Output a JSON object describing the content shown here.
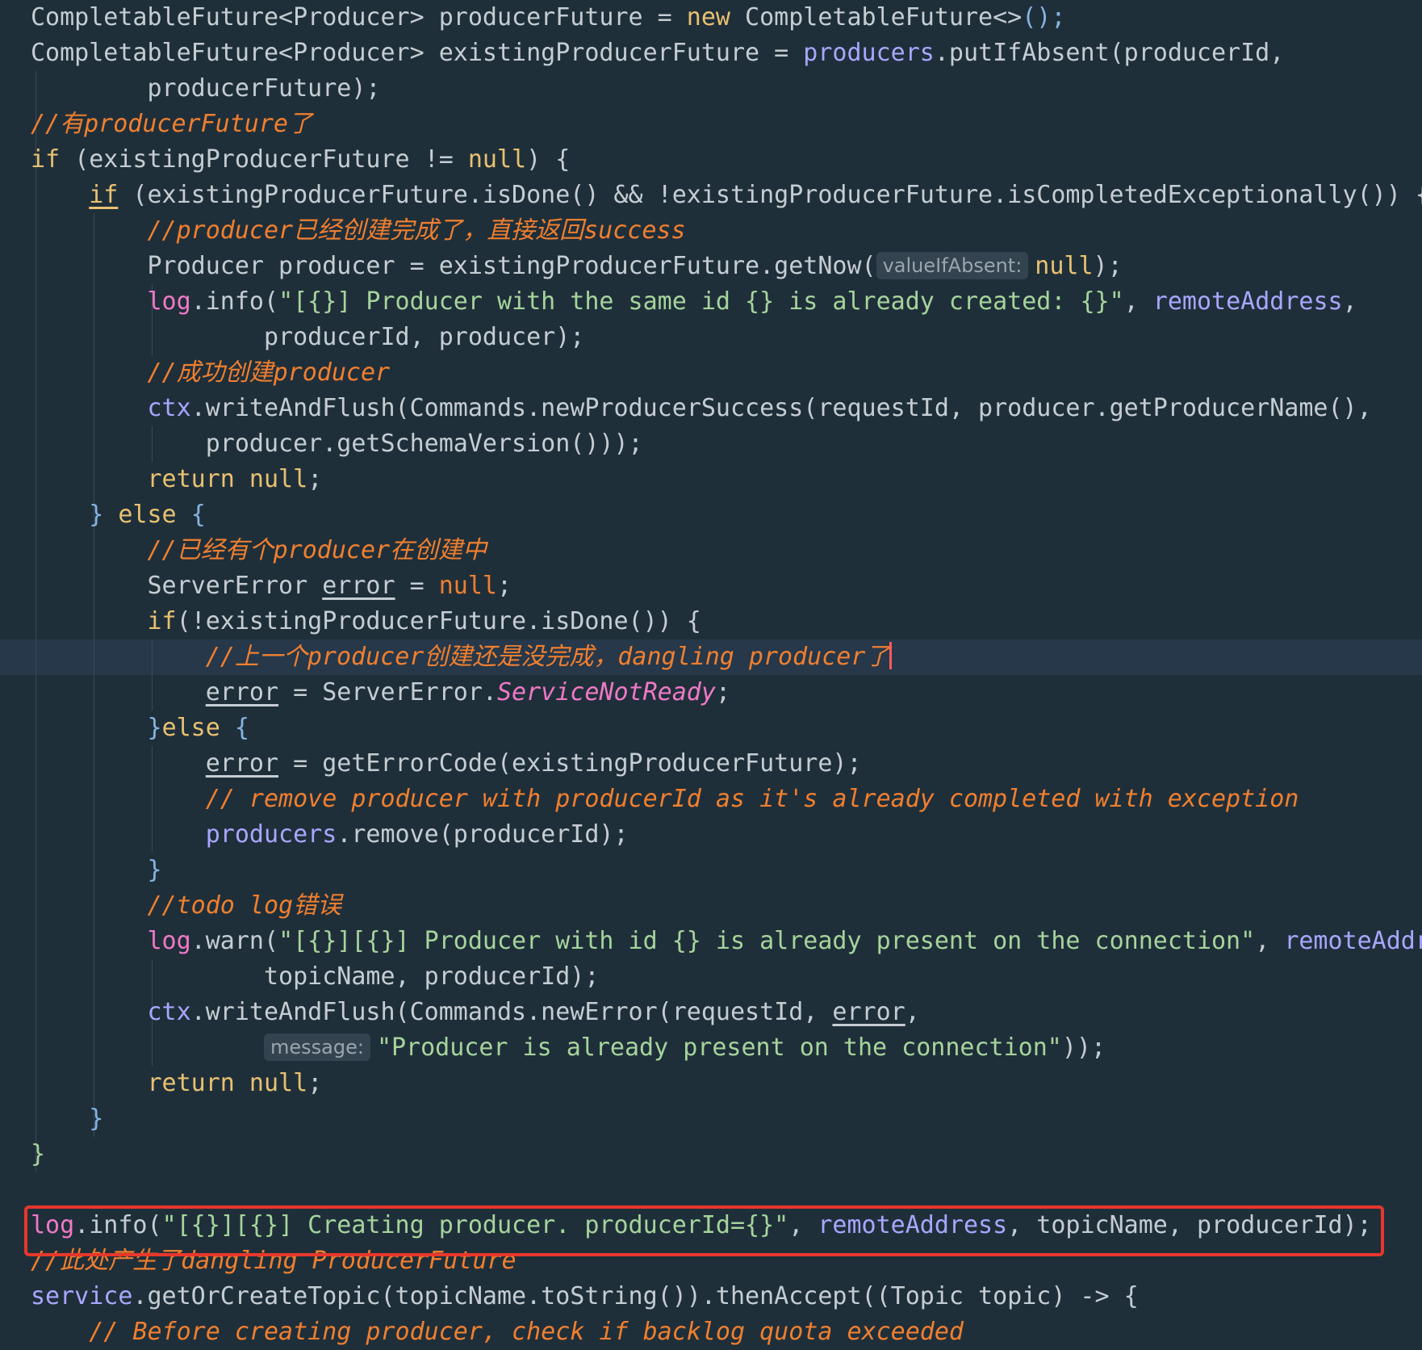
{
  "editor": {
    "lines": [
      [
        {
          "t": "CompletableFuture<Producer> producerFuture = ",
          "c": "ty"
        },
        {
          "t": "new ",
          "c": "kw"
        },
        {
          "t": "CompletableFuture<>",
          "c": "ty"
        },
        {
          "t": "();",
          "c": "par"
        }
      ],
      [
        {
          "t": "CompletableFuture<Producer> existingProducerFuture = ",
          "c": "ty"
        },
        {
          "t": "producers",
          "c": "fld"
        },
        {
          "t": ".putIfAbsent(producerId,",
          "c": "ty"
        }
      ],
      [
        {
          "t": "        producerFuture);",
          "c": "ty"
        }
      ],
      [
        {
          "t": "//有producerFuture了",
          "c": "cmt"
        }
      ],
      [
        {
          "t": "if ",
          "c": "kw"
        },
        {
          "t": "(existingProducerFuture != ",
          "c": "ty"
        },
        {
          "t": "null",
          "c": "kw"
        },
        {
          "t": ") {",
          "c": "ty"
        }
      ],
      [
        {
          "t": "    ",
          "c": "ty"
        },
        {
          "t": "if",
          "c": "kw uv"
        },
        {
          "t": " (existingProducerFuture.isDone() && !existingProducerFuture.isCompletedExceptionally()) {",
          "c": "ty"
        }
      ],
      [
        {
          "t": "        //producer已经创建完成了，直接返回success",
          "c": "cmt"
        }
      ],
      [
        {
          "t": "        Producer producer = existingProducerFuture.getNow(",
          "c": "ty"
        },
        {
          "t": "valueIfAbsent:",
          "c": "inlay"
        },
        {
          "t": "null",
          "c": "kw"
        },
        {
          "t": ");",
          "c": "ty"
        }
      ],
      [
        {
          "t": "        ",
          "c": "ty"
        },
        {
          "t": "log",
          "c": "log"
        },
        {
          "t": ".info(",
          "c": "ty"
        },
        {
          "t": "\"[{}] Producer with the same id {} is already created: {}\"",
          "c": "str"
        },
        {
          "t": ", ",
          "c": "ty"
        },
        {
          "t": "remoteAddress",
          "c": "fld"
        },
        {
          "t": ",",
          "c": "ty"
        }
      ],
      [
        {
          "t": "                producerId, producer);",
          "c": "ty"
        }
      ],
      [
        {
          "t": "        //成功创建producer",
          "c": "cmt"
        }
      ],
      [
        {
          "t": "        ",
          "c": "ty"
        },
        {
          "t": "ctx",
          "c": "fld"
        },
        {
          "t": ".writeAndFlush(Commands.newProducerSuccess(requestId, producer.getProducerName(),",
          "c": "ty"
        }
      ],
      [
        {
          "t": "            producer.getSchemaVersion()));",
          "c": "ty"
        }
      ],
      [
        {
          "t": "        ",
          "c": "ty"
        },
        {
          "t": "return null",
          "c": "kw"
        },
        {
          "t": ";",
          "c": "ty"
        }
      ],
      [
        {
          "t": "    } ",
          "c": "par"
        },
        {
          "t": "else ",
          "c": "kw"
        },
        {
          "t": "{",
          "c": "par"
        }
      ],
      [
        {
          "t": "        //已经有个producer在创建中",
          "c": "cmt"
        }
      ],
      [
        {
          "t": "        ServerError ",
          "c": "ty"
        },
        {
          "t": "error",
          "c": "ty uv"
        },
        {
          "t": " = ",
          "c": "ty"
        },
        {
          "t": "null",
          "c": "cmt-n"
        },
        {
          "t": ";",
          "c": "ty"
        }
      ],
      [
        {
          "t": "        ",
          "c": "ty"
        },
        {
          "t": "if",
          "c": "kw"
        },
        {
          "t": "(!existingProducerFuture.isDone()) {",
          "c": "ty"
        }
      ],
      [
        {
          "t": "            //上一个producer创建还是没完成，dangling producer了",
          "c": "cmt"
        },
        {
          "t": "",
          "c": "caret"
        }
      ],
      [
        {
          "t": "            ",
          "c": "ty"
        },
        {
          "t": "error",
          "c": "ty uv"
        },
        {
          "t": " = ServerError.",
          "c": "ty"
        },
        {
          "t": "ServiceNotReady",
          "c": "const"
        },
        {
          "t": ";",
          "c": "ty"
        }
      ],
      [
        {
          "t": "        }",
          "c": "par"
        },
        {
          "t": "else ",
          "c": "kw"
        },
        {
          "t": "{",
          "c": "par"
        }
      ],
      [
        {
          "t": "            ",
          "c": "ty"
        },
        {
          "t": "error",
          "c": "ty uv"
        },
        {
          "t": " = getErrorCode(existingProducerFuture);",
          "c": "ty"
        }
      ],
      [
        {
          "t": "            // remove producer with producerId as it's already completed with exception",
          "c": "cmt"
        }
      ],
      [
        {
          "t": "            ",
          "c": "ty"
        },
        {
          "t": "producers",
          "c": "fld"
        },
        {
          "t": ".remove(producerId);",
          "c": "ty"
        }
      ],
      [
        {
          "t": "        }",
          "c": "par"
        }
      ],
      [
        {
          "t": "        //todo log错误",
          "c": "cmt"
        }
      ],
      [
        {
          "t": "        ",
          "c": "ty"
        },
        {
          "t": "log",
          "c": "log"
        },
        {
          "t": ".warn(",
          "c": "ty"
        },
        {
          "t": "\"[{}][{}] Producer with id {} is already present on the connection\"",
          "c": "str"
        },
        {
          "t": ", ",
          "c": "ty"
        },
        {
          "t": "remoteAddr",
          "c": "fld"
        }
      ],
      [
        {
          "t": "                topicName, producerId);",
          "c": "ty"
        }
      ],
      [
        {
          "t": "        ",
          "c": "ty"
        },
        {
          "t": "ctx",
          "c": "fld"
        },
        {
          "t": ".writeAndFlush(Commands.newError(requestId, ",
          "c": "ty"
        },
        {
          "t": "error",
          "c": "ty uv"
        },
        {
          "t": ",",
          "c": "ty"
        }
      ],
      [
        {
          "t": "                ",
          "c": "ty"
        },
        {
          "t": "message:",
          "c": "inlay"
        },
        {
          "t": "\"Producer is already present on the connection\"",
          "c": "str"
        },
        {
          "t": "));",
          "c": "ty"
        }
      ],
      [
        {
          "t": "        ",
          "c": "ty"
        },
        {
          "t": "return null",
          "c": "kw"
        },
        {
          "t": ";",
          "c": "ty"
        }
      ],
      [
        {
          "t": "    }",
          "c": "par"
        }
      ],
      [
        {
          "t": "}",
          "c": "str"
        }
      ],
      [],
      [
        {
          "t": "log",
          "c": "log"
        },
        {
          "t": ".info(",
          "c": "ty"
        },
        {
          "t": "\"[{}][{}] Creating producer. producerId={}\"",
          "c": "str"
        },
        {
          "t": ", ",
          "c": "ty"
        },
        {
          "t": "remoteAddress",
          "c": "fld"
        },
        {
          "t": ", topicName, producerId);",
          "c": "ty"
        }
      ],
      [
        {
          "t": "//此处产生了dangling ProducerFuture",
          "c": "cmt"
        }
      ],
      [
        {
          "t": "service",
          "c": "fld"
        },
        {
          "t": ".getOrCreateTopic(topicName.toString()).thenAccept((Topic topic) -> {",
          "c": "ty"
        }
      ],
      [
        {
          "t": "    // Before creating producer, check if backlog quota exceeded",
          "c": "cmt"
        }
      ]
    ],
    "current_line": 18,
    "highlighted_line": 34
  },
  "colors": {
    "background": "#1f2f3a",
    "highlight_box": "#e8372c",
    "caret": "#ff5a5a"
  }
}
